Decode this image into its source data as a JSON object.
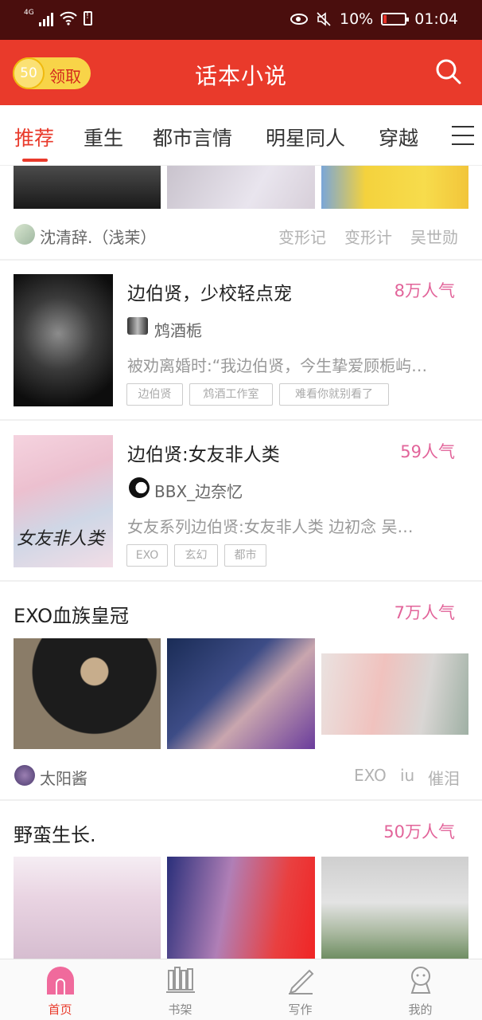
{
  "status_bar": {
    "network": "4G",
    "battery_percent": "10%",
    "time": "01:04"
  },
  "app_bar": {
    "coin_count": "50",
    "coin_label": "领取",
    "title": "话本小说"
  },
  "tabs": [
    "推荐",
    "重生",
    "都市言情",
    "明星同人",
    "穿越"
  ],
  "active_tab": 0,
  "feed": {
    "card1": {
      "author": "沈清辞.（浅茉）",
      "tags": [
        "变形记",
        "变形计",
        "吴世勋"
      ]
    },
    "book1": {
      "title": "边伯贤，少校轻点宠",
      "popularity": "8万人气",
      "author": "鸩酒栀",
      "description": "被劝离婚时:“我边伯贤，今生挚爱顾栀屿…",
      "chips": [
        "边伯贤",
        "鸩酒工作室",
        "难看你就别看了"
      ]
    },
    "book2": {
      "title": "边伯贤:女友非人类",
      "popularity": "59人气",
      "author": "BBX_边奈忆",
      "description": "女友系列边伯贤:女友非人类 边初念 吴…",
      "chips": [
        "EXO",
        "玄幻",
        "都市"
      ],
      "cover_text": "女友非人类"
    },
    "card2": {
      "title": "EXO血族皇冠",
      "popularity": "7万人气",
      "author": "太阳酱",
      "tags": [
        "EXO",
        "iu",
        "催泪"
      ]
    },
    "card3": {
      "title": "野蛮生长.",
      "popularity": "50万人气"
    }
  },
  "bottom_nav": [
    "首页",
    "书架",
    "写作",
    "我的"
  ],
  "colors": {
    "brand_red": "#e93a2b",
    "popularity_pink": "#e2649a",
    "status_bar": "#4a0e0d"
  }
}
